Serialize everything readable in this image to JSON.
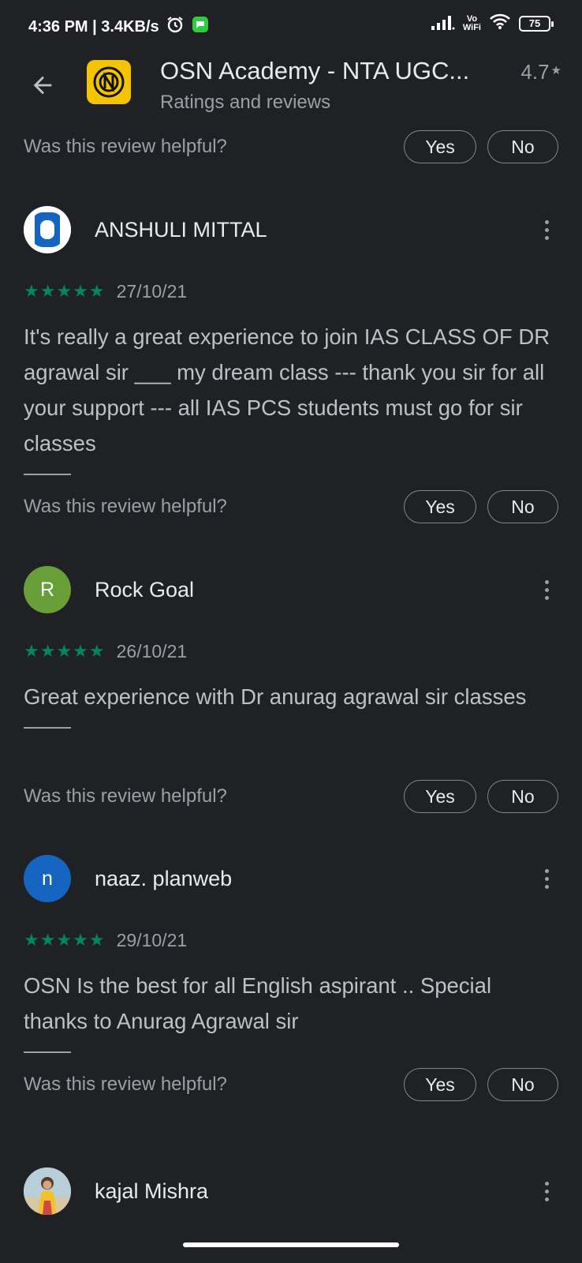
{
  "status_bar": {
    "left_text": "4:36 PM | 3.4KB/s",
    "vo": "Vo",
    "wifi_label": "WiFi",
    "battery": "75",
    "icons": [
      "alarm-icon",
      "message-icon",
      "signal-icon",
      "wifi-icon"
    ]
  },
  "app_bar": {
    "title": "OSN Academy - NTA UGC...",
    "subtitle": "Ratings and reviews",
    "rating": "4.7",
    "rating_star": "★",
    "brand_color": "#f5c400"
  },
  "helpful": {
    "question": "Was this review helpful?",
    "yes": "Yes",
    "no": "No"
  },
  "reviews": [
    {
      "name": "ANSHULI MITTAL",
      "avatar_letter": "",
      "avatar_color": "#ffffff",
      "stars": "★★★★★",
      "date": "27/10/21",
      "text": "It's really a great experience to join IAS CLASS OF DR agrawal sir ___ my dream class --- thank you sir for all your support --- all IAS PCS students must go for sir classes"
    },
    {
      "name": "Rock Goal",
      "avatar_letter": "R",
      "avatar_color": "#689f38",
      "stars": "★★★★★",
      "date": "26/10/21",
      "text": "Great experience with Dr anurag agrawal sir classes"
    },
    {
      "name": "naaz. planweb",
      "avatar_letter": "n",
      "avatar_color": "#1565c0",
      "stars": "★★★★★",
      "date": "29/10/21",
      "text": "OSN Is the best for all English aspirant .. Special thanks to Anurag Agrawal sir"
    },
    {
      "name": "kajal Mishra",
      "avatar_letter": "",
      "avatar_color": "#c48a6a"
    }
  ],
  "colors": {
    "background": "#202124",
    "star_green": "#01875f",
    "secondary_text": "#9aa0a6"
  }
}
